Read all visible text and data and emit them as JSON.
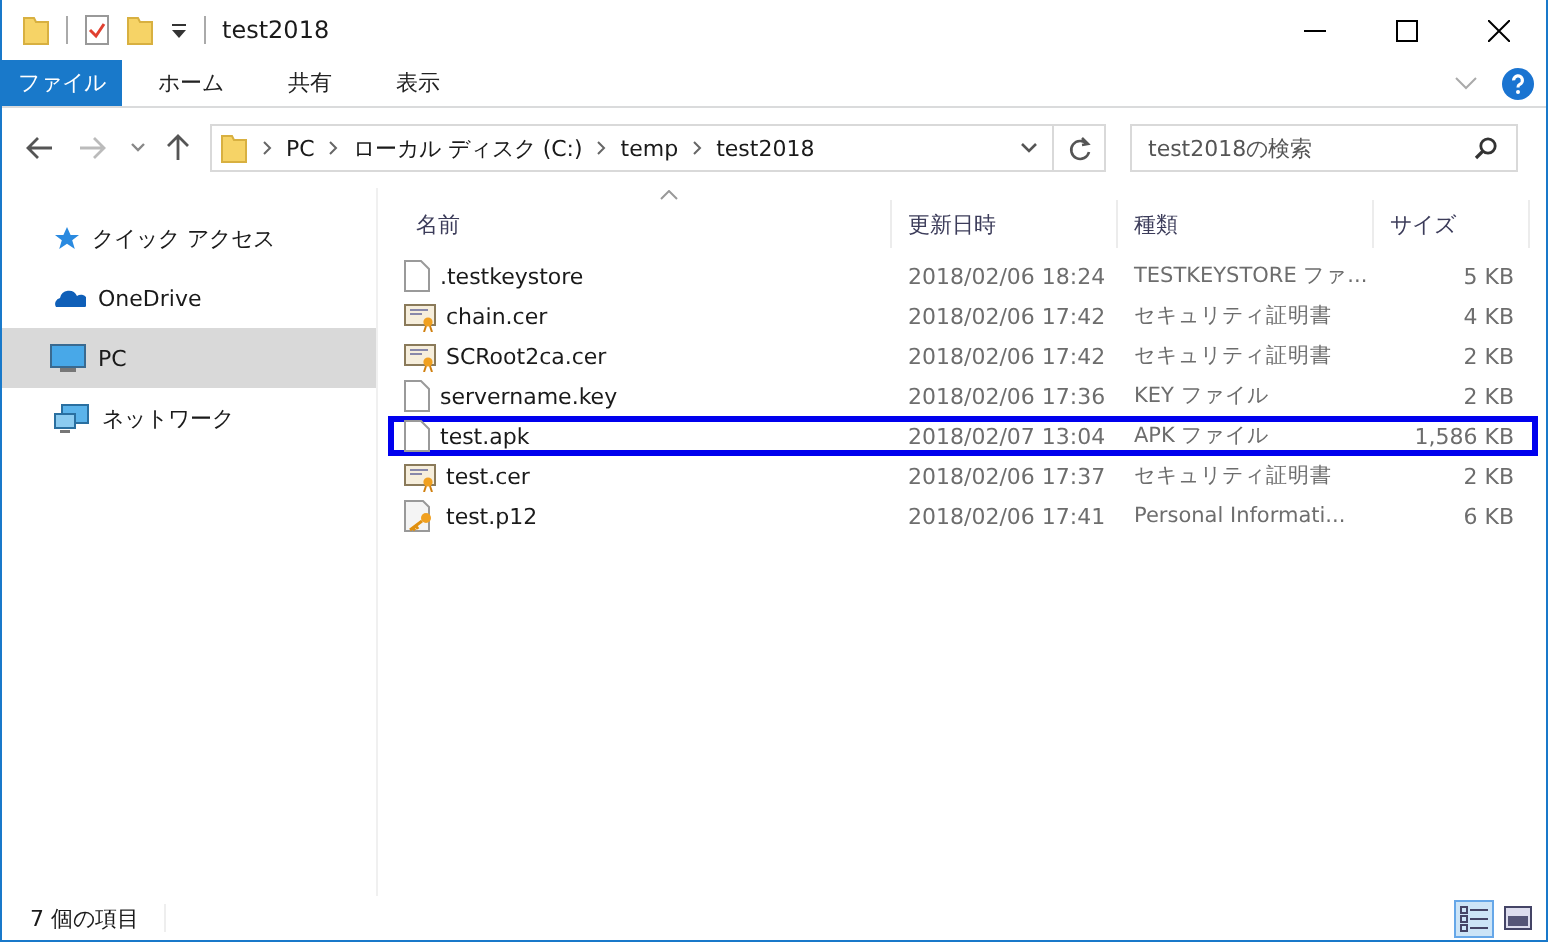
{
  "window": {
    "title": "test2018"
  },
  "ribbon_tabs": [
    {
      "label": "ファイル",
      "selected": true
    },
    {
      "label": "ホーム",
      "selected": false
    },
    {
      "label": "共有",
      "selected": false
    },
    {
      "label": "表示",
      "selected": false
    }
  ],
  "address_bar": {
    "segments": [
      "PC",
      "ローカル ディスク (C:)",
      "temp",
      "test2018"
    ]
  },
  "search": {
    "placeholder": "test2018の検索"
  },
  "sidebar": {
    "items": [
      {
        "label": "クイック アクセス",
        "kind": "star",
        "selected": false
      },
      {
        "label": "OneDrive",
        "kind": "cloud",
        "selected": false
      },
      {
        "label": "PC",
        "kind": "pc",
        "selected": true
      },
      {
        "label": "ネットワーク",
        "kind": "network",
        "selected": false
      }
    ]
  },
  "table": {
    "columns": [
      "名前",
      "更新日時",
      "種類",
      "サイズ"
    ],
    "rows": [
      {
        "kind": "document",
        "name": ".testkeystore",
        "date": "2018/02/06 18:24",
        "type": "TESTKEYSTORE ファ...",
        "size": "5 KB",
        "highlighted": false
      },
      {
        "kind": "certificate",
        "name": "chain.cer",
        "date": "2018/02/06 17:42",
        "type": "セキュリティ証明書",
        "size": "4 KB",
        "highlighted": false
      },
      {
        "kind": "certificate",
        "name": "SCRoot2ca.cer",
        "date": "2018/02/06 17:42",
        "type": "セキュリティ証明書",
        "size": "2 KB",
        "highlighted": false
      },
      {
        "kind": "document",
        "name": "servername.key",
        "date": "2018/02/06 17:36",
        "type": "KEY ファイル",
        "size": "2 KB",
        "highlighted": false
      },
      {
        "kind": "document",
        "name": "test.apk",
        "date": "2018/02/07 13:04",
        "type": "APK ファイル",
        "size": "1,586 KB",
        "highlighted": true
      },
      {
        "kind": "certificate",
        "name": "test.cer",
        "date": "2018/02/06 17:37",
        "type": "セキュリティ証明書",
        "size": "2 KB",
        "highlighted": false
      },
      {
        "kind": "keyfile",
        "name": "test.p12",
        "date": "2018/02/06 17:41",
        "type": "Personal Informati...",
        "size": "6 KB",
        "highlighted": false
      }
    ]
  },
  "status_bar": {
    "text": "7 個の項目"
  }
}
